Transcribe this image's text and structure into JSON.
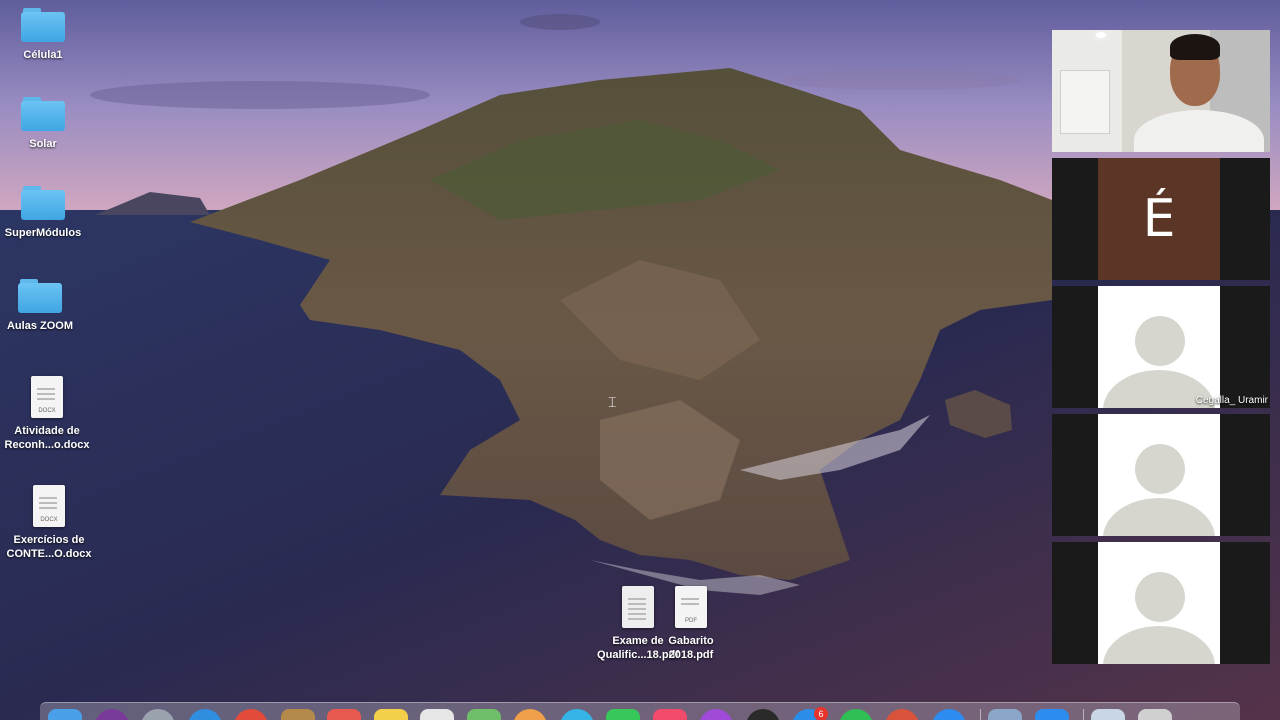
{
  "desktop": {
    "icons": [
      {
        "label": "Célula1",
        "kind": "folder"
      },
      {
        "label": "Solar",
        "kind": "folder"
      },
      {
        "label": "SuperMódulos",
        "kind": "folder"
      },
      {
        "label": "Aulas ZOOM",
        "kind": "folder"
      },
      {
        "label_line1": "Atividade de",
        "label_line2": "Reconh...o.docx",
        "kind": "document",
        "ext": "DOCX"
      },
      {
        "label_line1": "Exercícios de",
        "label_line2": "CONTE...O.docx",
        "kind": "document",
        "ext": "DOCX"
      },
      {
        "label_line1": "Exame de",
        "label_line2": "Qualific...18.pdf",
        "kind": "pdf"
      },
      {
        "label_line1": "Gabarito",
        "label_line2": "2018.pdf",
        "kind": "pdf",
        "ext": "PDF"
      }
    ]
  },
  "videos": {
    "tiles": [
      {
        "type": "camera"
      },
      {
        "type": "letter",
        "letter": "É"
      },
      {
        "type": "avatar",
        "name": "Cegalla_ Uramir"
      },
      {
        "type": "avatar",
        "name": ""
      },
      {
        "type": "avatar",
        "name": ""
      }
    ]
  },
  "dock": {
    "badge_count": "6",
    "items": [
      {
        "icon": "finder-icon",
        "color": "#4aa0e8"
      },
      {
        "icon": "siri-icon",
        "color": "#7a3a9a"
      },
      {
        "icon": "launchpad-icon",
        "color": "#9aa3ad"
      },
      {
        "icon": "safari-icon",
        "color": "#2f8ee0"
      },
      {
        "icon": "chrome-icon",
        "color": "#e24a3a"
      },
      {
        "icon": "notes-folder-icon",
        "color": "#b38a4a"
      },
      {
        "icon": "calendar-icon",
        "color": "#e8594f"
      },
      {
        "icon": "notes-icon",
        "color": "#f2d04a"
      },
      {
        "icon": "textedit-icon",
        "color": "#e6e6e6"
      },
      {
        "icon": "maps-icon",
        "color": "#6fbf6a"
      },
      {
        "icon": "photos-icon",
        "color": "#f0a04a"
      },
      {
        "icon": "messages-icon",
        "color": "#35b4e8"
      },
      {
        "icon": "facetime-icon",
        "color": "#38c75a"
      },
      {
        "icon": "music-icon",
        "color": "#f24b6b"
      },
      {
        "icon": "podcasts-icon",
        "color": "#a04ad8"
      },
      {
        "icon": "tv-icon",
        "color": "#2a2a2a"
      },
      {
        "icon": "appstore-icon",
        "color": "#2a8ee8"
      },
      {
        "icon": "whatsapp-icon",
        "color": "#2fbf55"
      },
      {
        "icon": "powerpoint-icon",
        "color": "#d9533a"
      },
      {
        "icon": "zoom-icon",
        "color": "#2d8cf0"
      },
      {
        "icon": "preview-icon",
        "color": "#8aa6c8"
      },
      {
        "icon": "zoom-app-icon",
        "color": "#2d8cf0"
      },
      {
        "icon": "downloads-icon",
        "color": "#c9d6e6"
      },
      {
        "icon": "trash-icon",
        "color": "#d0d0d0"
      }
    ]
  }
}
